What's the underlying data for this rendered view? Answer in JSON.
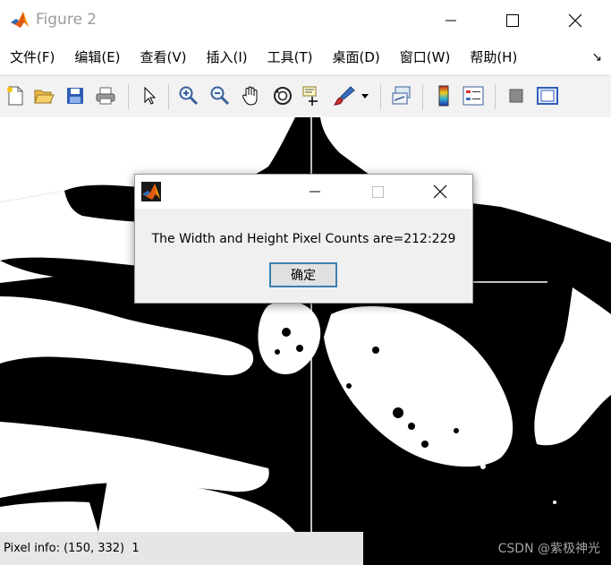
{
  "window": {
    "title": "Figure 2",
    "controls": {
      "minimize_icon": "minimize-icon",
      "maximize_icon": "maximize-icon",
      "close_icon": "close-icon"
    }
  },
  "menu": {
    "items": [
      "文件(F)",
      "编辑(E)",
      "查看(V)",
      "插入(I)",
      "工具(T)",
      "桌面(D)",
      "窗口(W)",
      "帮助(H)"
    ],
    "overflow_glyph": "↘"
  },
  "toolbar": {
    "buttons": [
      "new-figure-icon",
      "open-file-icon",
      "save-icon",
      "print-icon",
      "select-arrow-icon",
      "zoom-in-icon",
      "zoom-out-icon",
      "pan-hand-icon",
      "rotate-3d-icon",
      "data-cursor-icon",
      "brush-icon",
      "brush-dropdown-icon",
      "link-plot-icon",
      "colorbar-icon",
      "legend-icon",
      "hide-plot-tools-icon",
      "show-plot-tools-icon"
    ]
  },
  "dialog": {
    "message": "The Width and Height Pixel Counts are=212:229",
    "ok_label": "确定"
  },
  "status": {
    "pixel_info": "Pixel info: (150, 332)  1",
    "watermark": "CSDN @紫极神光"
  },
  "colors": {
    "title_text": "#9a9a9a",
    "dialog_button_border": "#3c7fb1",
    "figure_bg": "#000000",
    "foreground": "#ffffff"
  }
}
